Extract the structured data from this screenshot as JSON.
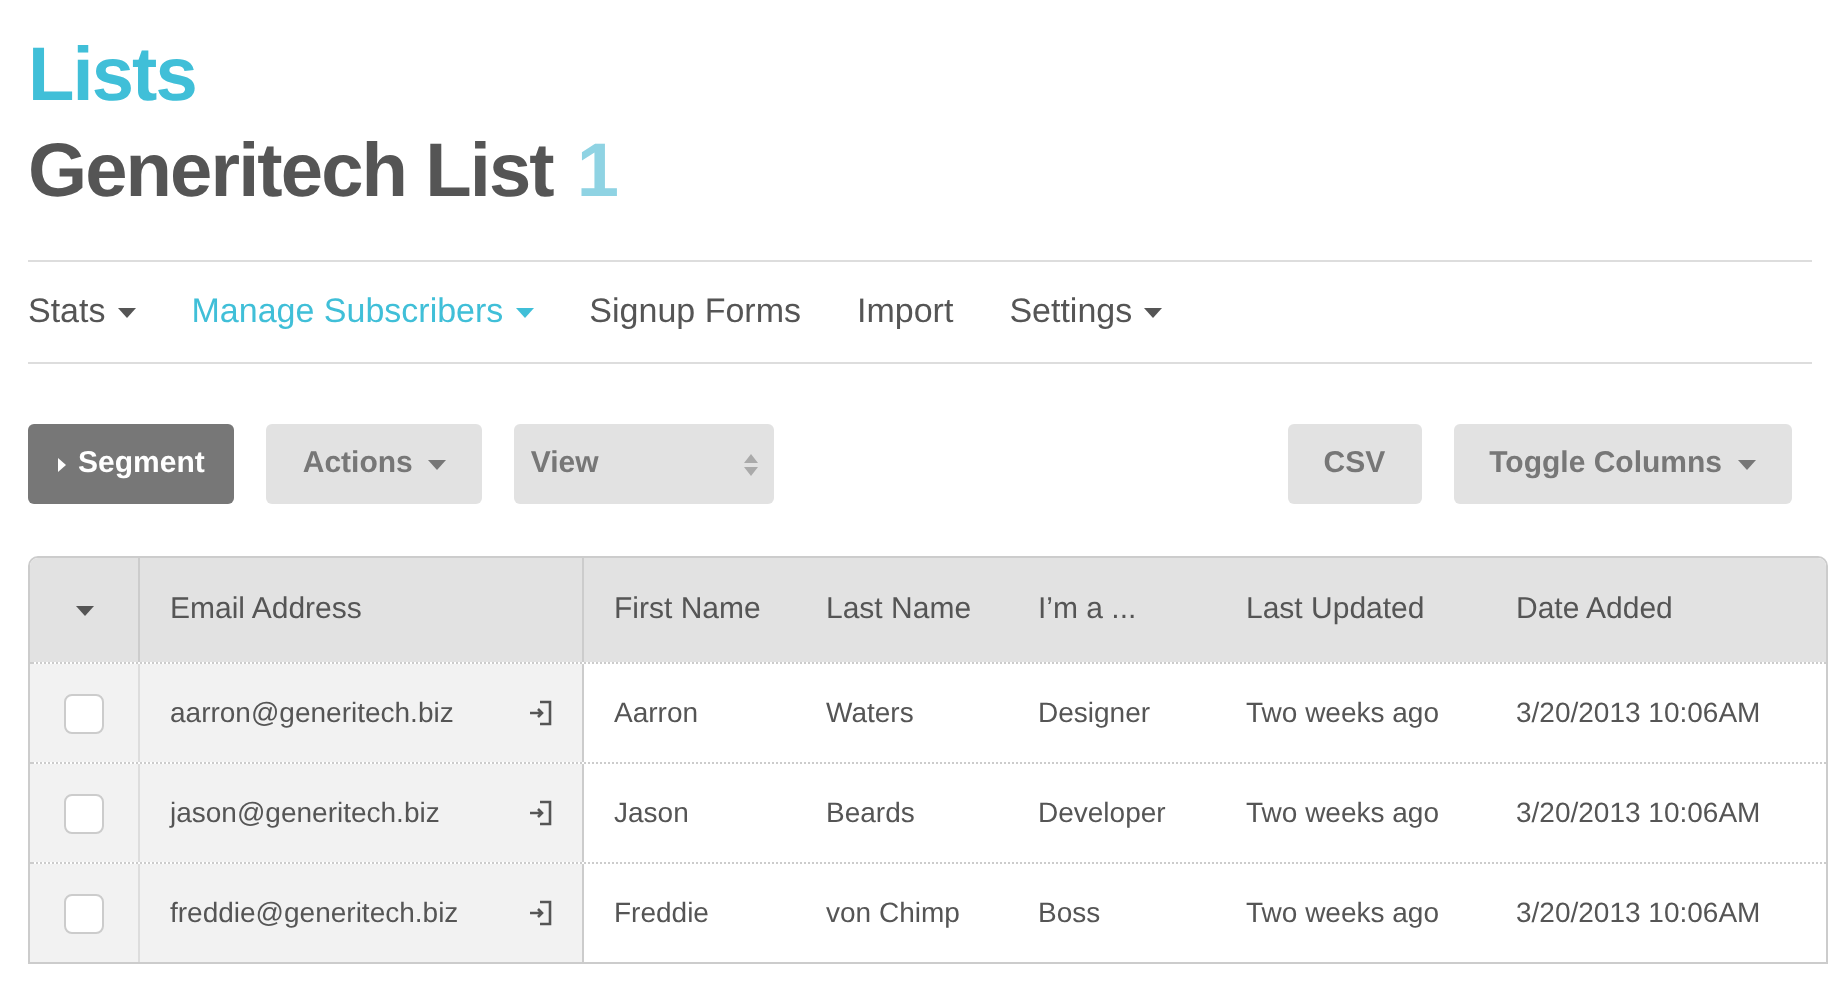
{
  "header": {
    "section": "Lists",
    "title": "Generitech List",
    "count": "1"
  },
  "nav": [
    {
      "label": "Stats",
      "selected": false,
      "dropdown": true
    },
    {
      "label": "Manage Subscribers",
      "selected": true,
      "dropdown": true
    },
    {
      "label": "Signup Forms",
      "selected": false,
      "dropdown": false
    },
    {
      "label": "Import",
      "selected": false,
      "dropdown": false
    },
    {
      "label": "Settings",
      "selected": false,
      "dropdown": true
    }
  ],
  "toolbar": {
    "segment": "Segment",
    "actions": "Actions",
    "view": "View",
    "csv": "CSV",
    "toggle_columns": "Toggle Columns"
  },
  "table": {
    "columns": [
      "Email Address",
      "First Name",
      "Last Name",
      "I’m a ...",
      "Last Updated",
      "Date Added"
    ],
    "rows": [
      {
        "checked": false,
        "cells": [
          "aarron@generitech.biz",
          "Aarron",
          "Waters",
          "Designer",
          "Two weeks ago",
          "3/20/2013 10:06AM"
        ]
      },
      {
        "checked": false,
        "cells": [
          "jason@generitech.biz",
          "Jason",
          "Beards",
          "Developer",
          "Two weeks ago",
          "3/20/2013 10:06AM"
        ]
      },
      {
        "checked": false,
        "cells": [
          "freddie@generitech.biz",
          "Freddie",
          "von Chimp",
          "Boss",
          "Two weeks ago",
          "3/20/2013 10:06AM"
        ]
      }
    ]
  }
}
